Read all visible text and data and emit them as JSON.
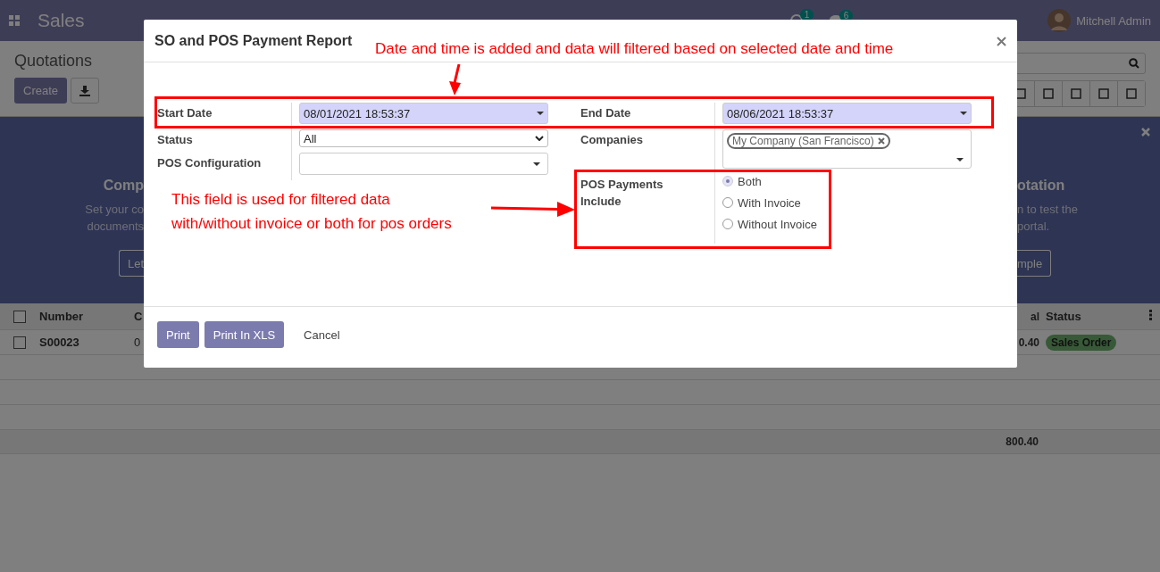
{
  "app": {
    "title": "Sales",
    "activity_count": "1",
    "message_count": "6",
    "user": "Mitchell Admin"
  },
  "control_panel": {
    "title": "Quotations",
    "create_button": "Create"
  },
  "banner": {
    "left_heading": "Comp",
    "left_lines": [
      "Set your co",
      "documents"
    ],
    "left_button": "Let",
    "right_heading": "otation",
    "right_lines": [
      "n to test the",
      "portal."
    ],
    "right_button": "mple"
  },
  "table": {
    "header_checked": false,
    "columns": [
      "Number",
      "C",
      "al",
      "Status"
    ],
    "rows": [
      {
        "checked": false,
        "number": "S00023",
        "column_3": "0",
        "total": "0.40",
        "status": "Sales Order"
      }
    ],
    "footer_total": "800.40"
  },
  "dialog": {
    "title": "SO and POS Payment Report",
    "left_fields": [
      {
        "kind": "date",
        "label": "Start Date",
        "value": "08/01/2021 18:53:37"
      },
      {
        "kind": "select",
        "label": "Status",
        "value": "All"
      },
      {
        "kind": "many2one",
        "label": "POS Configuration"
      }
    ],
    "right_fields": [
      {
        "kind": "date",
        "label": "End Date",
        "value": "08/06/2021 18:53:37"
      },
      {
        "kind": "tags",
        "label": "Companies",
        "tags": [
          "My Company (San Francisco)"
        ]
      },
      {
        "kind": "radio",
        "label": "POS Payments Include",
        "options": [
          {
            "label": "Both",
            "selected": true
          },
          {
            "label": "With Invoice",
            "selected": false
          },
          {
            "label": "Without Invoice",
            "selected": false
          }
        ]
      }
    ],
    "buttons": [
      {
        "label": "Print",
        "primary": true
      },
      {
        "label": "Print In XLS",
        "primary": true
      },
      {
        "label": "Cancel",
        "primary": false
      }
    ]
  },
  "annotations": {
    "top_note": "Date and time is added and data will filtered based on selected date and time",
    "side_note_lines": [
      "This field is used for filtered data",
      "with/without invoice or both for pos orders"
    ]
  }
}
